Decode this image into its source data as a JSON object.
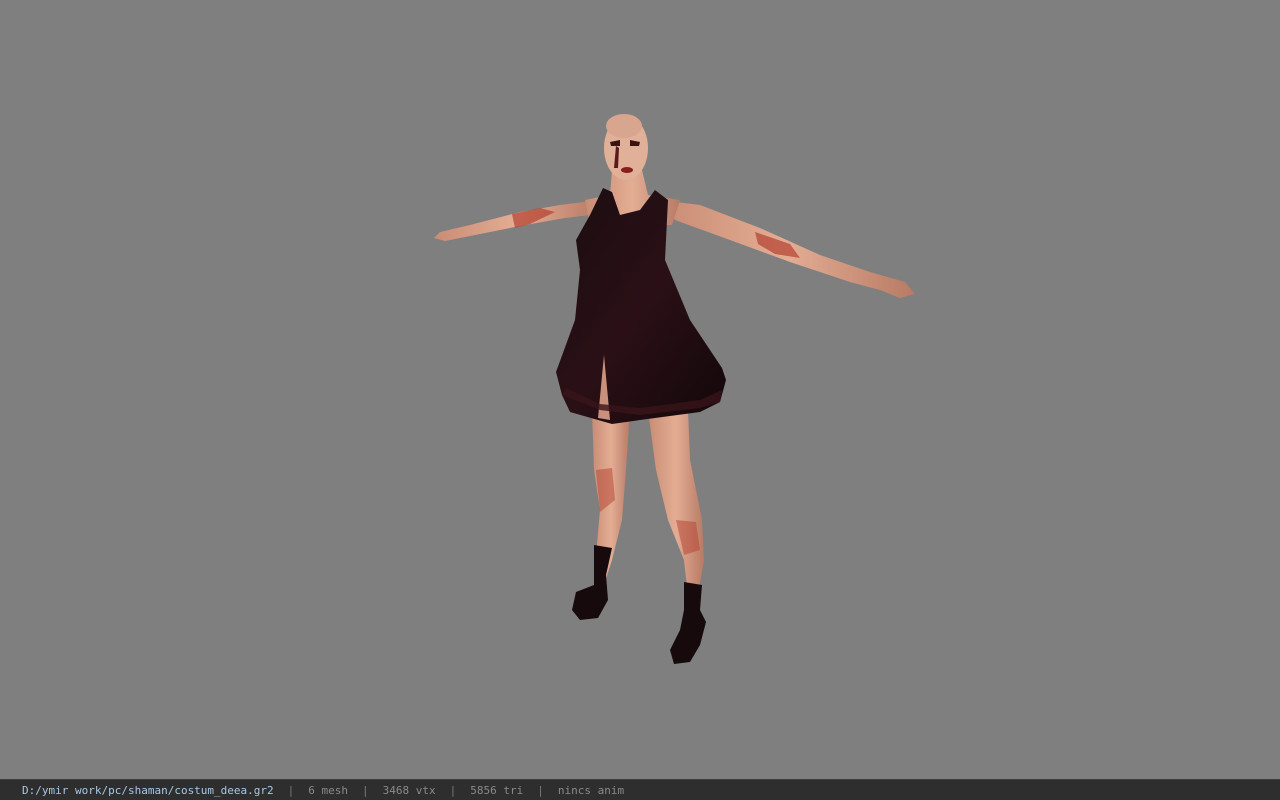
{
  "viewer": {
    "background_color": "#7f7f7f",
    "model_icon": "character-model-icon"
  },
  "status_bar": {
    "file_path": "D:/ymir work/pc/shaman/costum_deea.gr2",
    "separator": "|",
    "mesh": "6 mesh",
    "vertices": "3468 vtx",
    "triangles": "5856 tri",
    "animation": "nincs anim"
  }
}
